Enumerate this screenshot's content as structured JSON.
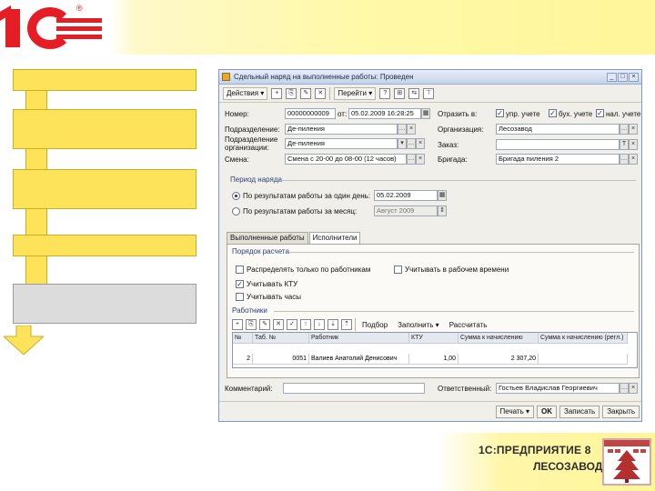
{
  "window": {
    "title": "Сдельный наряд на выполненные работы: Проведен",
    "controls": [
      "_",
      "□",
      "×"
    ]
  },
  "toolbar": {
    "actions_label": "Действия",
    "goto_label": "Перейти",
    "help_label": "?",
    "icons": [
      "add-icon",
      "copy-icon",
      "edit-icon",
      "delete-icon",
      "post-icon",
      "help-icon",
      "structure-icon",
      "move-icon",
      "tree-icon"
    ]
  },
  "header": {
    "number_label": "Номер:",
    "number_value": "00000000009",
    "from_label": "от:",
    "date_value": "05.02.2009 16:28:25",
    "division_label": "Подразделение:",
    "division_value": "Де-пиления",
    "org_division_label": "Подразделение организации:",
    "org_division_value": "Де-пиления",
    "shift_label": "Смена:",
    "shift_value": "Смена с 20-00 до 08-00 (12 часов)",
    "reflect_label": "Отразить в:",
    "reflect_options": [
      {
        "label": "упр. учете",
        "checked": true
      },
      {
        "label": "бух. учете",
        "checked": true
      },
      {
        "label": "нал. учете",
        "checked": true
      }
    ],
    "org_label": "Организация:",
    "org_value": "Лесозавод",
    "order_label": "Заказ:",
    "order_value": "",
    "brigade_label": "Бригада:",
    "brigade_value": "Бригада пиления 2"
  },
  "period": {
    "title": "Период наряда",
    "opt1_label": "По результатам работы за один день:",
    "opt1_value": "05.02.2009",
    "opt2_label": "По результатам работы за месяц:",
    "opt2_value": "Август 2009"
  },
  "tabs": [
    {
      "label": "Выполненные работы",
      "active": false
    },
    {
      "label": "Исполнители",
      "active": true
    }
  ],
  "calc": {
    "title": "Порядок расчета",
    "distribute_label": "Распределять только по работникам",
    "distribute_checked": false,
    "worktime_label": "Учитывать в рабочем времени",
    "worktime_checked": false,
    "ktu_label": "Учитывать КТУ",
    "ktu_checked": true,
    "hours_label": "Учитывать часы",
    "hours_checked": false
  },
  "workers": {
    "title": "Работники",
    "selection_label": "Подбор",
    "fill_label": "Заполнить",
    "calculate_label": "Рассчитать",
    "columns": [
      "№",
      "Таб. №",
      "Работник",
      "КТУ",
      "Сумма к начислению",
      "Сумма к начислению (регл.)"
    ],
    "rows": [
      [
        "2",
        "0051",
        "Валиев Анатолий Денисович",
        "1,00",
        "2 307,20",
        ""
      ]
    ]
  },
  "footer": {
    "comment_label": "Комментарий:",
    "comment_value": "",
    "responsible_label": "Ответственный:",
    "responsible_value": "Гостьев Владислав Георгиевич"
  },
  "buttons": {
    "print": "Печать",
    "ok": "OK",
    "save": "Записать",
    "close": "Закрыть"
  },
  "brand": {
    "line1": "1С:ПРЕДПРИЯТИЕ 8",
    "line2": "ЛЕСОЗАВОД"
  },
  "colors": {
    "flow_box": "#fde35a",
    "flow_box_grey": "#dcdcdc",
    "logo_red": "#e51d24"
  }
}
